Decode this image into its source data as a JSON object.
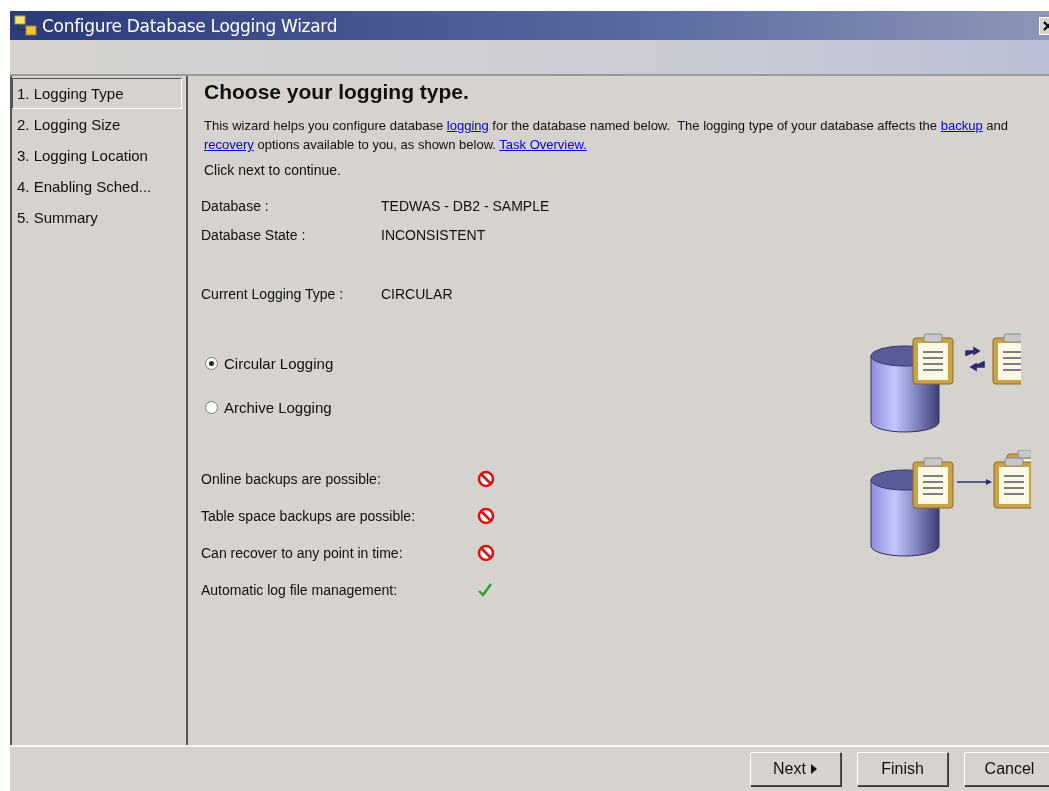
{
  "window": {
    "title": "Configure Database Logging Wizard"
  },
  "steps": [
    {
      "label": "1. Logging Type",
      "selected": true
    },
    {
      "label": "2. Logging Size",
      "selected": false
    },
    {
      "label": "3. Logging Location",
      "selected": false
    },
    {
      "label": "4. Enabling Sched...",
      "selected": false
    },
    {
      "label": "5. Summary",
      "selected": false
    }
  ],
  "heading": "Choose your logging type.",
  "intro": [
    {
      "text": "This wizard helps you configure database ",
      "link": false
    },
    {
      "text": "logging",
      "link": true
    },
    {
      "text": " for the database named below.  The logging type of your database affects the ",
      "link": false
    },
    {
      "text": "backup",
      "link": true
    },
    {
      "text": " and ",
      "link": false
    },
    {
      "text": "recovery",
      "link": true
    },
    {
      "text": " options available to you, as shown below. ",
      "link": false
    },
    {
      "text": "Task Overview.",
      "link": true
    }
  ],
  "instruction": "Click next to continue.",
  "details": [
    {
      "label": "Database :",
      "value": "TEDWAS - DB2 - SAMPLE"
    },
    {
      "label": "Database State :",
      "value": "INCONSISTENT"
    },
    {
      "label": "Current Logging Type :",
      "value": "CIRCULAR"
    }
  ],
  "options": [
    {
      "label": "Circular Logging",
      "selected": true
    },
    {
      "label": "Archive Logging",
      "selected": false
    }
  ],
  "features": [
    {
      "label": "Online backups are possible:",
      "available": false
    },
    {
      "label": "Table space backups are possible:",
      "available": false
    },
    {
      "label": "Can recover to any point in time:",
      "available": false
    },
    {
      "label": "Automatic log file management:",
      "available": true
    }
  ],
  "buttons": [
    {
      "label": "Next",
      "kind": "next"
    },
    {
      "label": "Finish",
      "kind": "plain"
    },
    {
      "label": "Cancel",
      "kind": "plain"
    }
  ]
}
